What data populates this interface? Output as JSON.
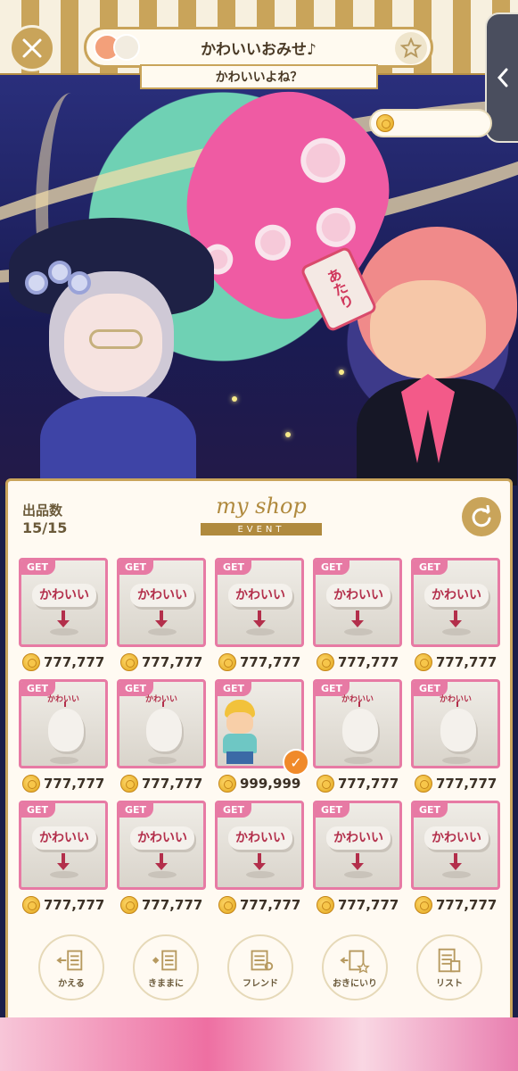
{
  "header": {
    "title": "かわいいおみせ♪",
    "subtitle": "かわいいよね？",
    "coin_value": ""
  },
  "panel": {
    "count_label": "出品数",
    "count_value": "15/15",
    "logo_text": "my shop",
    "logo_sub": "EVENT"
  },
  "items": [
    {
      "badge": "GET",
      "type": "sign",
      "sign_text": "かわいい",
      "price": "777,777"
    },
    {
      "badge": "GET",
      "type": "sign",
      "sign_text": "かわいい",
      "price": "777,777"
    },
    {
      "badge": "GET",
      "type": "sign",
      "sign_text": "かわいい",
      "price": "777,777"
    },
    {
      "badge": "GET",
      "type": "sign",
      "sign_text": "かわいい",
      "price": "777,777"
    },
    {
      "badge": "GET",
      "type": "sign",
      "sign_text": "かわいい",
      "price": "777,777"
    },
    {
      "badge": "GET",
      "type": "head",
      "sign_text": "かわいい",
      "price": "777,777"
    },
    {
      "badge": "GET",
      "type": "head",
      "sign_text": "かわいい",
      "price": "777,777"
    },
    {
      "badge": "GET",
      "type": "kid",
      "sign_text": "",
      "price": "999,999"
    },
    {
      "badge": "GET",
      "type": "head",
      "sign_text": "かわいい",
      "price": "777,777"
    },
    {
      "badge": "GET",
      "type": "head",
      "sign_text": "かわいい",
      "price": "777,777"
    },
    {
      "badge": "GET",
      "type": "sign",
      "sign_text": "かわいい",
      "price": "777,777"
    },
    {
      "badge": "GET",
      "type": "sign",
      "sign_text": "かわいい",
      "price": "777,777"
    },
    {
      "badge": "GET",
      "type": "sign",
      "sign_text": "かわいい",
      "price": "777,777"
    },
    {
      "badge": "GET",
      "type": "sign",
      "sign_text": "かわいい",
      "price": "777,777"
    },
    {
      "badge": "GET",
      "type": "sign",
      "sign_text": "かわいい",
      "price": "777,777"
    }
  ],
  "nav": [
    {
      "label": "かえる",
      "icon": "change-icon"
    },
    {
      "label": "きままに",
      "icon": "shuffle-icon"
    },
    {
      "label": "フレンド",
      "icon": "friend-icon"
    },
    {
      "label": "おきにいり",
      "icon": "favorite-icon"
    },
    {
      "label": "リスト",
      "icon": "list-icon"
    }
  ],
  "scene": {
    "tag_text": "あたり"
  },
  "colors": {
    "gold": "#c9a45a",
    "pink_border": "#e77aa4",
    "panel_bg": "#fffaf2",
    "heart_orange": "#f08a2a"
  }
}
